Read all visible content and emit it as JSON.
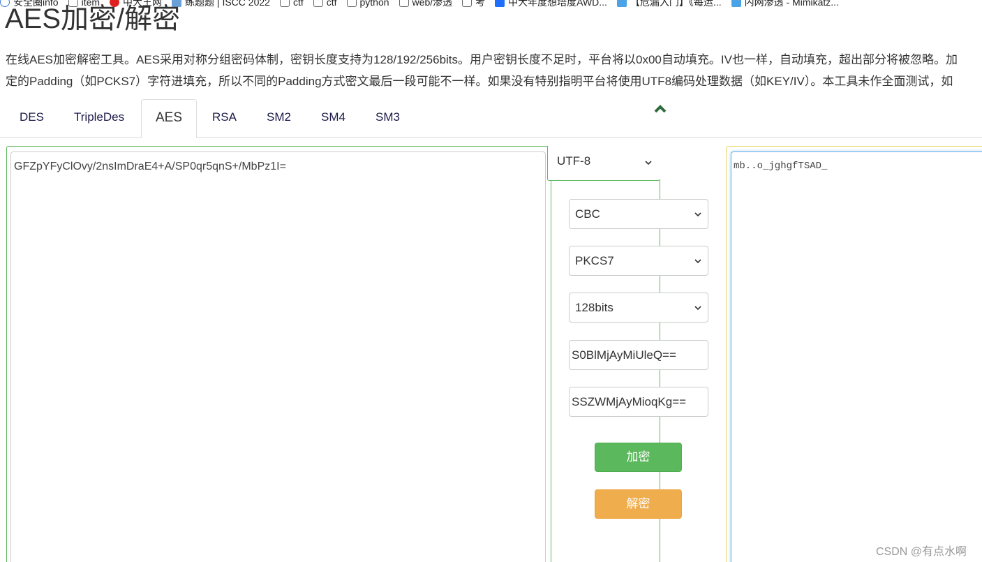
{
  "bookmarks": [
    {
      "label": "安全圈info",
      "icon": "globe-icon"
    },
    {
      "label": "item",
      "icon": "folder-icon"
    },
    {
      "label": "中大王网",
      "icon": "red-logo-icon"
    },
    {
      "label": "练题题 | ISCC 2022",
      "icon": "image-icon"
    },
    {
      "label": "ctf",
      "icon": "folder-icon"
    },
    {
      "label": "ctf",
      "icon": "folder-icon"
    },
    {
      "label": "python",
      "icon": "folder-icon"
    },
    {
      "label": "web/渗透",
      "icon": "folder-icon"
    },
    {
      "label": "考",
      "icon": "folder-icon"
    },
    {
      "label": "中大年度想培度AWD...",
      "icon": "zhihu-icon"
    },
    {
      "label": "【危漏入门】《每运...",
      "icon": "bookmark-icon"
    },
    {
      "label": "内网渗透 - Mimikatz...",
      "icon": "bookmark-icon"
    }
  ],
  "page": {
    "title": "AES加密/解密",
    "desc_line1": "在线AES加密解密工具。AES采用对称分组密码体制，密钥长度支持为128/192/256bits。用户密钥长度不足时，平台将以0x00自动填充。IV也一样，自动填充，超出部分将被忽略。加",
    "desc_line2": "定的Padding（如PCKS7）字符进填充，所以不同的Padding方式密文最后一段可能不一样。如果没有特别指明平台将使用UTF8编码处理数据（如KEY/IV）。本工具未作全面测试，如"
  },
  "tabs": [
    "DES",
    "TripleDes",
    "AES",
    "RSA",
    "SM2",
    "SM4",
    "SM3"
  ],
  "active_tab": "AES",
  "form": {
    "cipher_text": "GFZpYFyClOvy/2nsImDraE4+A/SP0qr5qnS+/MbPz1I=",
    "encoding": "UTF-8",
    "mode": "CBC",
    "padding": "PKCS7",
    "key_size": "128bits",
    "key": "S0BlMjAyMiUleQ==",
    "iv": "SSZWMjAyMioqKg==",
    "encrypt_label": "加密",
    "decrypt_label": "解密"
  },
  "output_text": "mb..o_jghgfTSAD_",
  "watermark": "CSDN @有点水啊",
  "colors": {
    "green": "#5cb85c",
    "orange": "#f0ad4e",
    "tab_text": "#1a1a4a"
  }
}
